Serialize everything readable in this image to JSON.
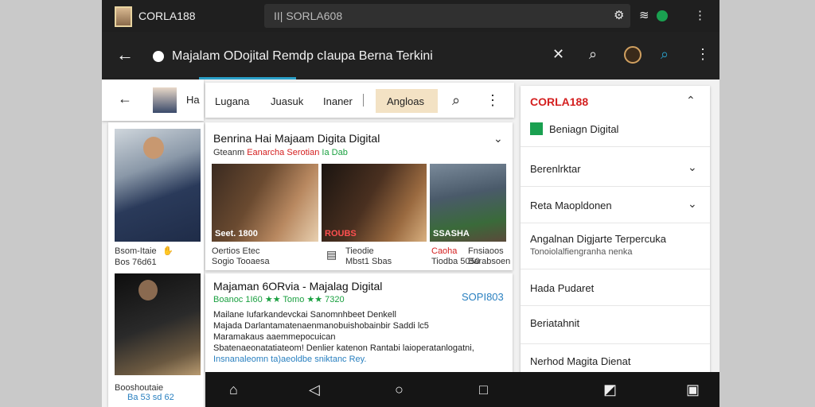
{
  "status_bar": {
    "app_name": "CORLA188",
    "search_text": "SORLA608",
    "search_prefix": "II|"
  },
  "app_bar": {
    "title": "Majalam ODojital Remdp cIaupa Berna Terkini"
  },
  "left_panel": {
    "top_label": "Ha",
    "items": [
      {
        "caption1": "Bsom-Itaie",
        "caption2": "Bos 76d61"
      },
      {
        "caption1": "Booshoutaie",
        "caption2": "Ba 53 sd 62"
      }
    ]
  },
  "tabs": [
    "Lugana",
    "Juasuk",
    "Inaner",
    "Angloas"
  ],
  "card1": {
    "title": "Benrina Hai Majaam Digita Digital",
    "meta_parts": [
      "Gteanm",
      "Eanarcha",
      "Serotian",
      "Ia Dab"
    ],
    "images": [
      {
        "label": "Seet. 1800",
        "caption1": "Oertios Etec",
        "caption2": "Sogio Tooaesa"
      },
      {
        "label": "ROUBS",
        "caption1": "Tieodie",
        "caption2": "Mbst1 Sbas"
      },
      {
        "label": "SSASHA",
        "caption1": "Caoha",
        "caption2": "Tiodba 5050",
        "caption1b": "Fnsiaoos",
        "caption2b": "Barabsoen"
      }
    ]
  },
  "card2": {
    "title": "Majaman 6ORvia - Majalag Digital",
    "badge": "SOPI803",
    "meta": "Boanoc 1I60 ★★ Tomo ★★ 7320",
    "lines": [
      "Mailane Iufarkandevckai Sanomnhbeet Denkell",
      "Majada Darlantamatenaenmanobuishobainbir Saddi lc5",
      "Maramakaus aaemmepocuican",
      "Sbatenaeonatatiateom! Denlier katenon Rantabi laioperatanlogatni,",
      "Insnanaleomn ta)aeoldbe sniktanc Rey."
    ]
  },
  "right_panel": {
    "brand": "CORLA188",
    "subtitle": "Beniagn Digital",
    "rows": [
      {
        "label": "Berenlrktar",
        "has_chevron": true
      },
      {
        "label": "Reta Maopldonen",
        "has_chevron": true
      },
      {
        "label": "Angalnan Digjarte Terpercuka",
        "sub": "Tonoiolalfiengranha nenka"
      },
      {
        "label": "Hada Pudaret"
      },
      {
        "label": "Beriatahnit"
      },
      {
        "label": "Nerhod Magita Dienat"
      }
    ]
  },
  "colors": {
    "accent": "#2aa0c8",
    "brand_red": "#d42020",
    "tab_active_bg": "#f3e2c4",
    "rating_green": "#1aa040"
  }
}
